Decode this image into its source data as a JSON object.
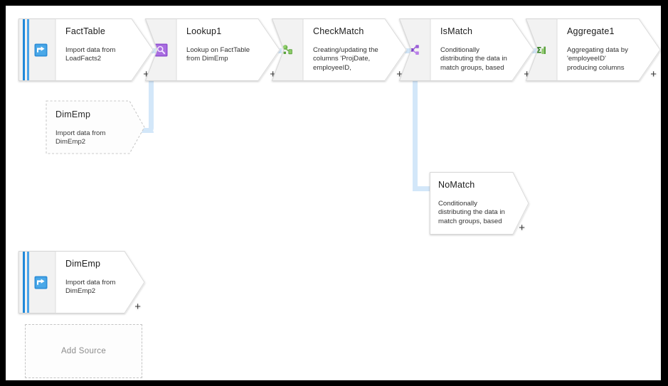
{
  "app": {
    "surface": "data-flow-canvas",
    "colors": {
      "connector": "#d3e7f9",
      "source_stripe": "#1f88d9",
      "canvas_bg": "#ffffff",
      "frame": "#000000",
      "rail_bg": "#f2f2f2"
    }
  },
  "add_source": {
    "label": "Add Source"
  },
  "nodes": [
    {
      "id": "factTable",
      "name": "FactTable",
      "description": "Import data from\nLoadFacts2",
      "kind": "source",
      "icon": "import-source-icon",
      "plus": "+"
    },
    {
      "id": "lookup1",
      "name": "Lookup1",
      "description": "Lookup on FactTable\nfrom DimEmp",
      "kind": "transformation",
      "icon": "lookup-icon",
      "plus": "+"
    },
    {
      "id": "checkMatch",
      "name": "CheckMatch",
      "description": "Creating/updating the\ncolumns 'ProjDate,\nemployeeID,",
      "kind": "transformation",
      "icon": "derived-column-icon",
      "plus": "+"
    },
    {
      "id": "isMatch",
      "name": "IsMatch",
      "description": "Conditionally\ndistributing the data in\nmatch groups, based",
      "kind": "transformation",
      "icon": "conditional-split-icon",
      "plus": "+"
    },
    {
      "id": "aggregate1",
      "name": "Aggregate1",
      "description": "Aggregating data by\n'employeeID'\nproducing columns",
      "kind": "transformation",
      "icon": "aggregate-sigma-icon",
      "plus": "+"
    },
    {
      "id": "noMatch",
      "name": "NoMatch",
      "description": "Conditionally\ndistributing the data in\nmatch groups, based",
      "kind": "branch",
      "icon": "none",
      "plus": "+"
    },
    {
      "id": "dimEmpSource",
      "name": "DimEmp",
      "description": "Import data from\nDimEmp2",
      "kind": "source",
      "icon": "import-source-icon",
      "plus": "+"
    }
  ],
  "ghost_nodes": [
    {
      "id": "dimEmpGhost",
      "name": "DimEmp",
      "description": "Import data from\nDimEmp2",
      "kind": "ghost-reference"
    }
  ]
}
